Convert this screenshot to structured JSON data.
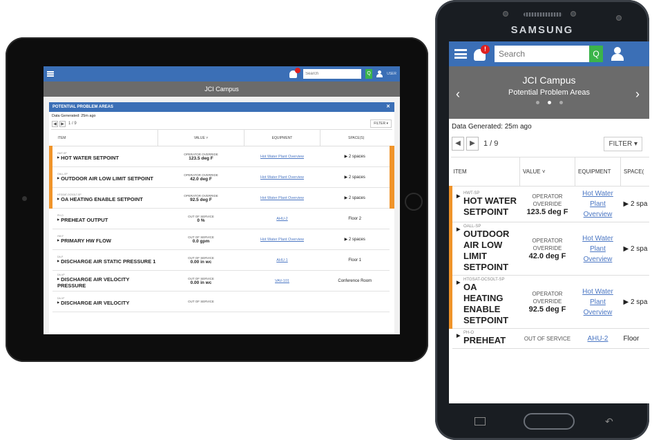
{
  "tablet": {
    "app_title": "JCI Campus",
    "search_placeholder": "Search",
    "search_button": "Q",
    "user_name": "USER",
    "panel_title": "POTENTIAL PROBLEM AREAS",
    "panel_close": "✕",
    "data_generated": "Data Generated: 25m ago",
    "page_prev": "◀",
    "page_next": "▶",
    "page_num": "1 / 9",
    "filter": "FILTER ▾",
    "columns": [
      "ITEM",
      "VALUE ˅",
      "EQUIPMENT",
      "SPACE(S)"
    ],
    "rows": [
      {
        "code": "HWT-SP",
        "name": "HOT WATER SETPOINT",
        "status": "OPERATOR OVERRIDE",
        "value": "123.5 deg F",
        "equipment": "Hot Water Plant Overview",
        "space": "▶ 2 spaces",
        "alarm": true
      },
      {
        "code": "OALL-SP",
        "name": "OUTDOOR AIR LOW LIMIT SETPOINT",
        "status": "OPERATOR OVERRIDE",
        "value": "42.0 deg F",
        "equipment": "Hot Water Plant Overview",
        "space": "▶ 2 spaces",
        "alarm": true
      },
      {
        "code": "HTGSAT-OCSOLT-SP",
        "name": "OA HEATING ENABLE SETPOINT",
        "status": "OPERATOR OVERRIDE",
        "value": "92.5 deg F",
        "equipment": "Hot Water Plant Overview",
        "space": "▶ 2 spaces",
        "alarm": true
      },
      {
        "code": "PH-O",
        "name": "PREHEAT OUTPUT",
        "status": "OUT OF SERVICE",
        "value": "0 %",
        "equipment": "AHU-2",
        "space": "Floor 2",
        "alarm": false
      },
      {
        "code": "HW-F",
        "name": "PRIMARY HW FLOW",
        "status": "OUT OF SERVICE",
        "value": "0.0 gpm",
        "equipment": "Hot Water Plant Overview",
        "space": "▶ 2 spaces",
        "alarm": false
      },
      {
        "code": "DA-P",
        "name": "DISCHARGE AIR STATIC PRESSURE 1",
        "status": "OUT OF SERVICE",
        "value": "0.00 in wc",
        "equipment": "AHU-1",
        "space": "Floor 1",
        "alarm": false
      },
      {
        "code": "DA-VP",
        "name": "DISCHARGE AIR VELOCITY PRESSURE",
        "status": "OUT OF SERVICE",
        "value": "0.00 in wc",
        "equipment": "VAV-101",
        "space": "Conference Room",
        "alarm": false
      },
      {
        "code": "DA-VF",
        "name": "DISCHARGE AIR VELOCITY",
        "status": "OUT OF SERVICE",
        "value": "",
        "equipment": "",
        "space": "",
        "alarm": false
      }
    ]
  },
  "phone": {
    "brand": "SAMSUNG",
    "search_placeholder": "Search",
    "search_button": "Q",
    "notif": "!",
    "banner_title": "JCI Campus",
    "banner_sub": "Potential Problem Areas",
    "arrow_left": "‹",
    "arrow_right": "›",
    "data_generated": "Data Generated: 25m ago",
    "page_prev": "◀",
    "page_next": "▶",
    "page_num": "1 / 9",
    "filter": "FILTER ▾",
    "columns": [
      "ITEM",
      "VALUE ˅",
      "EQUIPMENT",
      "SPACE("
    ],
    "rows": [
      {
        "code": "HWT-SP",
        "name": "HOT WATER SETPOINT",
        "status": "OPERATOR OVERRIDE",
        "value": "123.5 deg F",
        "equipment": "Hot Water Plant Overview",
        "space": "▶ 2 spa",
        "alarm": true
      },
      {
        "code": "OALL-SP",
        "name": "OUTDOOR AIR LOW LIMIT SETPOINT",
        "status": "OPERATOR OVERRIDE",
        "value": "42.0 deg F",
        "equipment": "Hot Water Plant Overview",
        "space": "▶ 2 spa",
        "alarm": true
      },
      {
        "code": "HTGSAT-OCSOLT-SP",
        "name": "OA HEATING ENABLE SETPOINT",
        "status": "OPERATOR OVERRIDE",
        "value": "92.5 deg F",
        "equipment": "Hot Water Plant Overview",
        "space": "▶ 2 spa",
        "alarm": true
      },
      {
        "code": "PH-O",
        "name": "PREHEAT",
        "status": "OUT OF SERVICE",
        "value": "",
        "equipment": "AHU-2",
        "space": "Floor",
        "alarm": false
      }
    ]
  },
  "colors": {
    "header_blue": "#3b6fb6",
    "alarm_orange": "#f0942a",
    "search_green": "#3bb44a",
    "banner_gray": "#6b6b6b",
    "link_blue": "#4a76c3"
  }
}
